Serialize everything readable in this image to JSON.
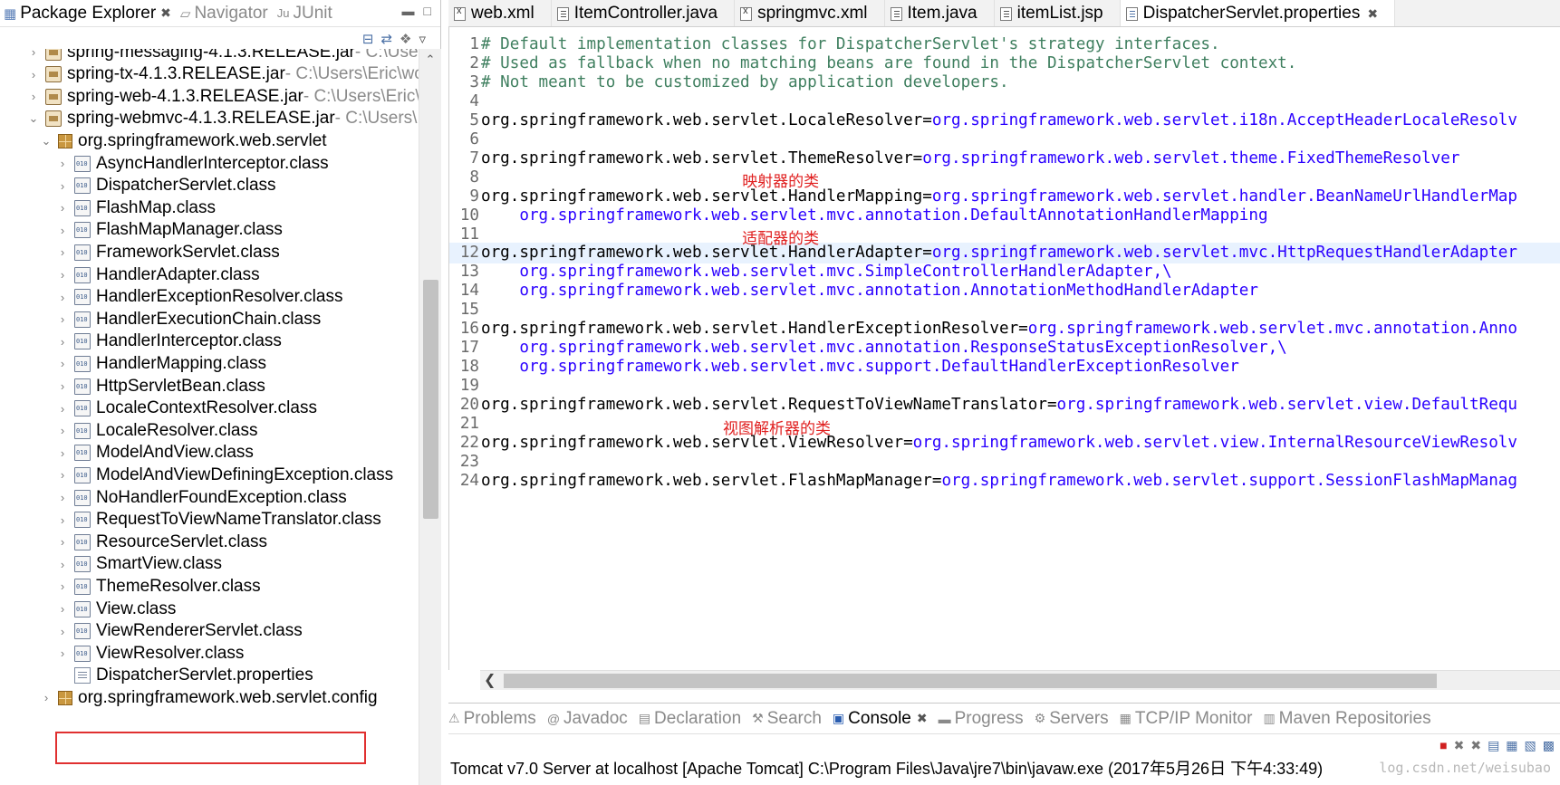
{
  "left_panel": {
    "tabs": [
      {
        "label": "Package Explorer",
        "close": "✖"
      },
      {
        "label": "Navigator"
      },
      {
        "label": "JUnit"
      }
    ],
    "view_icons": [
      "collapse-all-icon",
      "link-with-editor-icon",
      "view-filter-icon",
      "view-menu-icon"
    ],
    "tree": [
      {
        "indent": 0,
        "chev": "›",
        "icon": "jar",
        "label": "spring-messaging-4.1.3.RELEASE.jar",
        "suffix": " - C:\\Users\\Eric\\wo"
      },
      {
        "indent": 0,
        "chev": "›",
        "icon": "jar",
        "label": "spring-tx-4.1.3.RELEASE.jar",
        "suffix": " - C:\\Users\\Eric\\wo"
      },
      {
        "indent": 0,
        "chev": "›",
        "icon": "jar",
        "label": "spring-web-4.1.3.RELEASE.jar",
        "suffix": " - C:\\Users\\Eric\\w"
      },
      {
        "indent": 0,
        "chev": "⌄",
        "icon": "jar",
        "label": "spring-webmvc-4.1.3.RELEASE.jar",
        "suffix": " - C:\\Users\\E"
      },
      {
        "indent": 1,
        "chev": "⌄",
        "icon": "pkg",
        "label": "org.springframework.web.servlet",
        "suffix": ""
      },
      {
        "indent": 2,
        "chev": "›",
        "icon": "cls",
        "label": "AsyncHandlerInterceptor.class",
        "suffix": ""
      },
      {
        "indent": 2,
        "chev": "›",
        "icon": "cls",
        "label": "DispatcherServlet.class",
        "suffix": ""
      },
      {
        "indent": 2,
        "chev": "›",
        "icon": "cls",
        "label": "FlashMap.class",
        "suffix": ""
      },
      {
        "indent": 2,
        "chev": "›",
        "icon": "cls",
        "label": "FlashMapManager.class",
        "suffix": ""
      },
      {
        "indent": 2,
        "chev": "›",
        "icon": "cls",
        "label": "FrameworkServlet.class",
        "suffix": ""
      },
      {
        "indent": 2,
        "chev": "›",
        "icon": "cls",
        "label": "HandlerAdapter.class",
        "suffix": ""
      },
      {
        "indent": 2,
        "chev": "›",
        "icon": "cls",
        "label": "HandlerExceptionResolver.class",
        "suffix": ""
      },
      {
        "indent": 2,
        "chev": "›",
        "icon": "cls",
        "label": "HandlerExecutionChain.class",
        "suffix": ""
      },
      {
        "indent": 2,
        "chev": "›",
        "icon": "cls",
        "label": "HandlerInterceptor.class",
        "suffix": ""
      },
      {
        "indent": 2,
        "chev": "›",
        "icon": "cls",
        "label": "HandlerMapping.class",
        "suffix": ""
      },
      {
        "indent": 2,
        "chev": "›",
        "icon": "cls",
        "label": "HttpServletBean.class",
        "suffix": ""
      },
      {
        "indent": 2,
        "chev": "›",
        "icon": "cls",
        "label": "LocaleContextResolver.class",
        "suffix": ""
      },
      {
        "indent": 2,
        "chev": "›",
        "icon": "cls",
        "label": "LocaleResolver.class",
        "suffix": ""
      },
      {
        "indent": 2,
        "chev": "›",
        "icon": "cls",
        "label": "ModelAndView.class",
        "suffix": ""
      },
      {
        "indent": 2,
        "chev": "›",
        "icon": "cls",
        "label": "ModelAndViewDefiningException.class",
        "suffix": ""
      },
      {
        "indent": 2,
        "chev": "›",
        "icon": "cls",
        "label": "NoHandlerFoundException.class",
        "suffix": ""
      },
      {
        "indent": 2,
        "chev": "›",
        "icon": "cls",
        "label": "RequestToViewNameTranslator.class",
        "suffix": ""
      },
      {
        "indent": 2,
        "chev": "›",
        "icon": "cls",
        "label": "ResourceServlet.class",
        "suffix": ""
      },
      {
        "indent": 2,
        "chev": "›",
        "icon": "cls",
        "label": "SmartView.class",
        "suffix": ""
      },
      {
        "indent": 2,
        "chev": "›",
        "icon": "cls",
        "label": "ThemeResolver.class",
        "suffix": ""
      },
      {
        "indent": 2,
        "chev": "›",
        "icon": "cls",
        "label": "View.class",
        "suffix": ""
      },
      {
        "indent": 2,
        "chev": "›",
        "icon": "cls",
        "label": "ViewRendererServlet.class",
        "suffix": ""
      },
      {
        "indent": 2,
        "chev": "›",
        "icon": "cls",
        "label": "ViewResolver.class",
        "suffix": ""
      },
      {
        "indent": 2,
        "chev": "",
        "icon": "prop",
        "label": "DispatcherServlet.properties",
        "suffix": "",
        "selected": true
      },
      {
        "indent": 1,
        "chev": "›",
        "icon": "pkg",
        "label": "org.springframework.web.servlet.config",
        "suffix": ""
      }
    ]
  },
  "editor": {
    "tabs": [
      {
        "label": "web.xml",
        "icon": "x"
      },
      {
        "label": "ItemController.java",
        "icon": "j"
      },
      {
        "label": "springmvc.xml",
        "icon": "x"
      },
      {
        "label": "Item.java",
        "icon": "j"
      },
      {
        "label": "itemList.jsp",
        "icon": "j"
      },
      {
        "label": "DispatcherServlet.properties",
        "icon": "p",
        "active": true,
        "close": "✖"
      }
    ],
    "lines": [
      {
        "n": "1",
        "parts": [
          {
            "t": "# Default implementation classes for DispatcherServlet's strategy interfaces.",
            "c": "cmt"
          }
        ]
      },
      {
        "n": "2",
        "parts": [
          {
            "t": "# Used as fallback when no matching beans are found in the DispatcherServlet context.",
            "c": "cmt"
          }
        ]
      },
      {
        "n": "3",
        "parts": [
          {
            "t": "# Not meant to be customized by application developers.",
            "c": "cmt"
          }
        ]
      },
      {
        "n": "4",
        "parts": []
      },
      {
        "n": "5",
        "parts": [
          {
            "t": "org.springframework.web.servlet.LocaleResolver=",
            "c": ""
          },
          {
            "t": "org.springframework.web.servlet.i18n.AcceptHeaderLocaleResolv",
            "c": "val"
          }
        ]
      },
      {
        "n": "6",
        "parts": []
      },
      {
        "n": "7",
        "parts": [
          {
            "t": "org.springframework.web.servlet.ThemeResolver=",
            "c": ""
          },
          {
            "t": "org.springframework.web.servlet.theme.FixedThemeResolver",
            "c": "val"
          }
        ]
      },
      {
        "n": "8",
        "parts": []
      },
      {
        "n": "9",
        "parts": [
          {
            "t": "org.springframework.web.servlet.HandlerMapping=",
            "c": ""
          },
          {
            "t": "org.springframework.web.servlet.handler.BeanNameUrlHandlerMap",
            "c": "val"
          }
        ]
      },
      {
        "n": "10",
        "parts": [
          {
            "t": "    org.springframework.web.servlet.mvc.annotation.DefaultAnnotationHandlerMapping",
            "c": "val"
          }
        ]
      },
      {
        "n": "11",
        "parts": []
      },
      {
        "n": "12",
        "current": true,
        "parts": [
          {
            "t": "org.springframework.web.servlet.HandlerAdapter=",
            "c": ""
          },
          {
            "t": "org.springframework.web.servlet.mvc.HttpRequestHandlerAdapter",
            "c": "val"
          }
        ]
      },
      {
        "n": "13",
        "parts": [
          {
            "t": "    org.springframework.web.servlet.mvc.SimpleControllerHandlerAdapter,\\",
            "c": "val"
          }
        ]
      },
      {
        "n": "14",
        "parts": [
          {
            "t": "    org.springframework.web.servlet.mvc.annotation.AnnotationMethodHandlerAdapter",
            "c": "val"
          }
        ]
      },
      {
        "n": "15",
        "parts": []
      },
      {
        "n": "16",
        "parts": [
          {
            "t": "org.springframework.web.servlet.HandlerExceptionResolver=",
            "c": ""
          },
          {
            "t": "org.springframework.web.servlet.mvc.annotation.Anno",
            "c": "val"
          }
        ]
      },
      {
        "n": "17",
        "parts": [
          {
            "t": "    org.springframework.web.servlet.mvc.annotation.ResponseStatusExceptionResolver,\\",
            "c": "val"
          }
        ]
      },
      {
        "n": "18",
        "parts": [
          {
            "t": "    org.springframework.web.servlet.mvc.support.DefaultHandlerExceptionResolver",
            "c": "val"
          }
        ]
      },
      {
        "n": "19",
        "parts": []
      },
      {
        "n": "20",
        "parts": [
          {
            "t": "org.springframework.web.servlet.RequestToViewNameTranslator=",
            "c": ""
          },
          {
            "t": "org.springframework.web.servlet.view.DefaultRequ",
            "c": "val"
          }
        ]
      },
      {
        "n": "21",
        "parts": []
      },
      {
        "n": "22",
        "parts": [
          {
            "t": "org.springframework.web.servlet.ViewResolver=",
            "c": ""
          },
          {
            "t": "org.springframework.web.servlet.view.InternalResourceViewResolv",
            "c": "val"
          }
        ]
      },
      {
        "n": "23",
        "parts": []
      },
      {
        "n": "24",
        "parts": [
          {
            "t": "org.springframework.web.servlet.FlashMapManager=",
            "c": ""
          },
          {
            "t": "org.springframework.web.servlet.support.SessionFlashMapManag",
            "c": "val"
          }
        ]
      }
    ],
    "annotations": [
      {
        "text": "映射器的类",
        "line": "8",
        "col": 27
      },
      {
        "text": "适配器的类",
        "line": "11",
        "col": 27
      },
      {
        "text": "视图解析器的类",
        "line": "21",
        "col": 25
      }
    ]
  },
  "bottom_panel": {
    "tabs": [
      {
        "label": "Problems",
        "icon": "⚠"
      },
      {
        "label": "Javadoc",
        "icon": "@"
      },
      {
        "label": "Declaration",
        "icon": "▤"
      },
      {
        "label": "Search",
        "icon": "⚒"
      },
      {
        "label": "Console",
        "icon": "▣",
        "active": true,
        "close": "✖"
      },
      {
        "label": "Progress",
        "icon": "▬"
      },
      {
        "label": "Servers",
        "icon": "⚙"
      },
      {
        "label": "TCP/IP Monitor",
        "icon": "▦"
      },
      {
        "label": "Maven Repositories",
        "icon": "▥"
      }
    ],
    "console_title": "Tomcat v7.0 Server at localhost [Apache Tomcat] C:\\Program Files\\Java\\jre7\\bin\\javaw.exe (2017年5月26日 下午4:33:49)",
    "watermark": "log.csdn.net/weisubao"
  }
}
